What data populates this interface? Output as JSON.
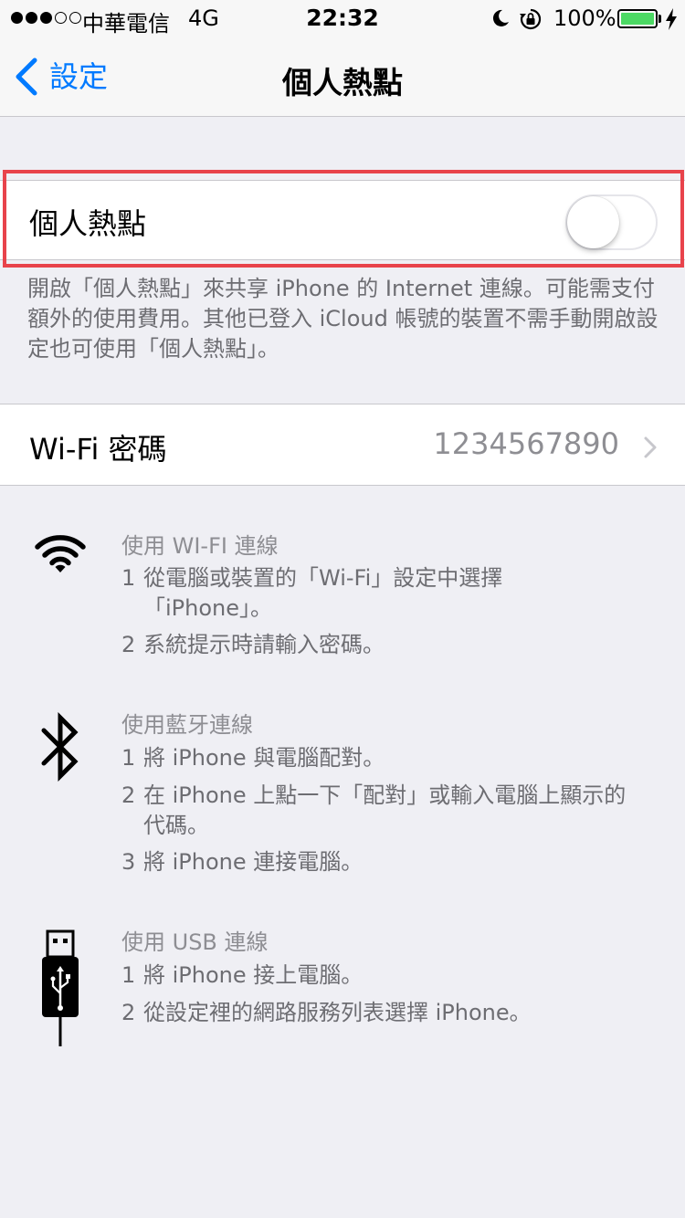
{
  "status_bar": {
    "carrier": "中華電信",
    "network": "4G",
    "time": "22:32",
    "battery_percent": "100%",
    "battery_level": 1.0,
    "signal_bars_filled": 3,
    "signal_bars_total": 5
  },
  "nav": {
    "back_label": "設定",
    "title": "個人熱點"
  },
  "hotspot": {
    "label": "個人熱點",
    "toggle_on": false,
    "note": "開啟「個人熱點」來共享 iPhone 的 Internet 連線。可能需支付額外的使用費用。其他已登入 iCloud 帳號的裝置不需手動開啟設定也可使用「個人熱點」。"
  },
  "wifi_password": {
    "label": "Wi-Fi 密碼",
    "value": "1234567890"
  },
  "instructions": {
    "wifi": {
      "title": "使用 WI-FI 連線",
      "step1_num": "1",
      "step1_line1": "從電腦或裝置的「Wi-Fi」設定中選擇",
      "step1_line2": "「iPhone」。",
      "step2_num": "2",
      "step2": "系統提示時請輸入密碼。"
    },
    "bluetooth": {
      "title": "使用藍牙連線",
      "step1_num": "1",
      "step1": "將 iPhone 與電腦配對。",
      "step2_num": "2",
      "step2_line1": "在 iPhone 上點一下「配對」或輸入電腦上顯示的",
      "step2_line2": "代碼。",
      "step3_num": "3",
      "step3": "將 iPhone 連接電腦。"
    },
    "usb": {
      "title": "使用 USB 連線",
      "step1_num": "1",
      "step1": "將 iPhone 接上電腦。",
      "step2_num": "2",
      "step2": "從設定裡的網路服務列表選擇 iPhone。"
    }
  },
  "colors": {
    "accent": "#007aff",
    "highlight_border": "#e8434b",
    "battery": "#4cd964",
    "background": "#efeff4"
  },
  "icons": {
    "wifi": "wifi-icon",
    "bluetooth": "bluetooth-icon",
    "usb": "usb-icon"
  }
}
